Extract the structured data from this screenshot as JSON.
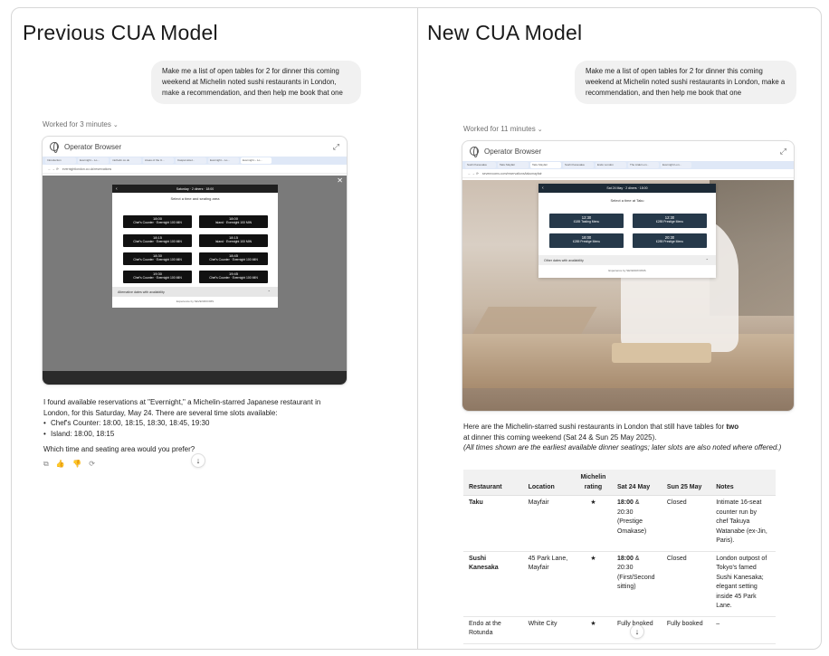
{
  "left": {
    "title": "Previous CUA Model",
    "prompt": "Make me a list of open tables for 2 for dinner this coming weekend at Michelin noted sushi restaurants in London, make a recommendation, and then help me book that one",
    "worked": "Worked for 3 minutes",
    "browser": {
      "title": "Operator Browser",
      "tabs": [
        "Introduction",
        "Evernight – Lo...",
        "michelin.co.uk",
        "Areas of the U...",
        "Caspa Hotel...",
        "Evernight – Lo...",
        "Evernight – Lo..."
      ],
      "url": "evernightlondon.co.uk/reservations",
      "modal_header": "Saturday · 2 diners · 18:00",
      "modal_subtitle": "Select a time and seating area",
      "slots": [
        {
          "time": "18:00",
          "label": "Chef's Counter · Evernight 100 MIN"
        },
        {
          "time": "18:00",
          "label": "Island · Evernight 100 MIN"
        },
        {
          "time": "18:15",
          "label": "Chef's Counter · Evernight 100 MIN"
        },
        {
          "time": "18:15",
          "label": "Island · Evernight 100 MIN"
        },
        {
          "time": "18:30",
          "label": "Chef's Counter · Evernight 100 MIN"
        },
        {
          "time": "18:45",
          "label": "Chef's Counter · Evernight 100 MIN"
        },
        {
          "time": "19:30",
          "label": "Chef's Counter · Evernight 100 MIN"
        },
        {
          "time": "19:45",
          "label": "Chef's Counter · Evernight 100 MIN"
        }
      ],
      "accordion": "Alternative dates with availability",
      "powered_by": "Experience by SEVENROOMS"
    },
    "answer_intro": "I found available reservations at \"Evernight,\" a Michelin-starred Japanese restaurant in London, for this Saturday, May 24. There are several time slots available:",
    "answer_items": [
      "Chef's Counter: 18:00, 18:15, 18:30, 18:45, 19:30",
      "Island: 18:00, 18:15"
    ],
    "answer_question": "Which time and seating area would you prefer?"
  },
  "right": {
    "title": "New CUA Model",
    "prompt": "Make me a list of open tables for 2 for dinner this coming weekend at Michelin noted sushi restaurants in London, make a recommendation, and then help me book that one",
    "worked": "Worked for 11 minutes",
    "browser": {
      "title": "Operator Browser",
      "tabs": [
        "Sushi Kanesaka",
        "Taku Mayfair",
        "Taku Mayfair",
        "Sushi Kanesaka",
        "Endo London",
        "The Araki Lon...",
        "Evernight Lon..."
      ],
      "url": "sevenrooms.com/reservations/takumayfair",
      "modal_header": "Sat 24 May · 2 diners · 18:00",
      "modal_subtitle": "Select a time at Taku",
      "slots": [
        {
          "time": "12:30",
          "label": "£185 Tasting Menu"
        },
        {
          "time": "12:30",
          "label": "£285 Prestige Menu"
        },
        {
          "time": "18:00",
          "label": "£285 Prestige Menu"
        },
        {
          "time": "20:30",
          "label": "£285 Prestige Menu"
        }
      ],
      "accordion": "Other dates with availability",
      "powered_by": "Experience by SEVENROOMS"
    },
    "answer_line1_pre": "Here are the Michelin-starred sushi restaurants in London that still have tables for ",
    "answer_line1_bold": "two",
    "answer_line2": "at dinner this coming weekend (Sat 24 & Sun 25 May 2025).",
    "answer_note": "(All times shown are the earliest available dinner seatings; later slots are also noted where offered.)",
    "table": {
      "headers": [
        "Restaurant",
        "Location",
        "Michelin rating",
        "Sat 24 May",
        "Sun 25 May",
        "Notes"
      ],
      "rows": [
        {
          "restaurant": "Taku",
          "location": "Mayfair",
          "rating": "★",
          "sat_bold": "18:00",
          "sat_rest": " & 20:30 (Prestige Omakase)",
          "sun": "Closed",
          "notes": "Intimate 16-seat counter run by chef Takuya Watanabe (ex-Jin, Paris)."
        },
        {
          "restaurant": "Sushi Kanesaka",
          "location": "45 Park Lane, Mayfair",
          "rating": "★",
          "sat_bold": "18:00",
          "sat_rest": " & 20:30 (First/Second sitting)",
          "sun": "Closed",
          "notes": "London outpost of Tokyo's famed Sushi Kanesaka; elegant setting inside 45 Park Lane."
        },
        {
          "restaurant": "Endo at the Rotunda",
          "location": "White City",
          "rating": "★",
          "sat_bold": "",
          "sat_rest": "Fully booked",
          "sun": "Fully booked",
          "notes": "–"
        }
      ]
    }
  }
}
